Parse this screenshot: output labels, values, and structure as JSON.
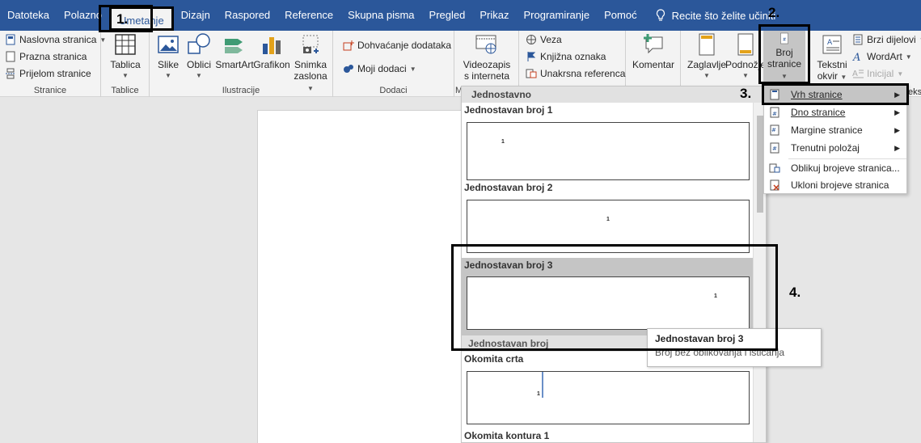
{
  "tabs": [
    "Datoteka",
    "Polazno",
    "Umetanje",
    "Dizajn",
    "Raspored",
    "Reference",
    "Skupna pisma",
    "Pregled",
    "Prikaz",
    "Programiranje",
    "Pomoć"
  ],
  "tell_me": "Recite što želite učiniti",
  "ribbon": {
    "stranice": {
      "label": "Stranice",
      "items": [
        "Naslovna stranica",
        "Prazna stranica",
        "Prijelom stranice"
      ]
    },
    "tablice": {
      "label": "Tablice",
      "button": "Tablica"
    },
    "ilustracije": {
      "label": "Ilustracije",
      "slike": "Slike",
      "oblici": "Oblici",
      "smartart": "SmartArt",
      "grafikon": "Grafikon",
      "snimka_l1": "Snimka",
      "snimka_l2": "zaslona"
    },
    "dodaci": {
      "label": "Dodaci",
      "dohvacanje": "Dohvaćanje dodataka",
      "moji": "Moji dodaci"
    },
    "mediji": {
      "label": "M",
      "l1": "Videozapis",
      "l2": "s interneta"
    },
    "veze": {
      "veza": "Veza",
      "knjizna": "Knjižna oznaka",
      "unakrsna": "Unakrsna referenca"
    },
    "komentar": "Komentar",
    "zaglavlje": {
      "zaglavlje": "Zaglavlje",
      "podnozje": "Podnožje",
      "broj_l1": "Broj",
      "broj_l2": "stranice"
    },
    "tekst": {
      "tekstni_l1": "Tekstni",
      "tekstni_l2": "okvir",
      "brzi": "Brzi dijelovi",
      "wordart": "WordArt",
      "inicijal": "Inicijal",
      "cut": "ekst"
    }
  },
  "gallery": {
    "header": "Jednostavno",
    "items": [
      {
        "title": "Jednostavan broj 1",
        "num": "1"
      },
      {
        "title": "Jednostavan broj 2",
        "num": "1"
      },
      {
        "title": "Jednostavan broj 3",
        "num": "1"
      },
      {
        "title": "Jednostavan broj",
        "num": ""
      },
      {
        "title": "Okomita crta",
        "num": "1"
      },
      {
        "title": "Okomita kontura 1",
        "num": ""
      }
    ]
  },
  "submenu": {
    "items": [
      "Vrh stranice",
      "Dno stranice",
      "Margine stranice",
      "Trenutni položaj",
      "Oblikuj brojeve stranica...",
      "Ukloni brojeve stranica"
    ]
  },
  "tooltip": {
    "title": "Jednostavan broj 3",
    "desc": "Broj bez oblikovanja i isticanja"
  },
  "annotations": [
    "1.",
    "2.",
    "3.",
    "4."
  ],
  "colors": {
    "ribbon_blue": "#2b579a",
    "highlight": "#c5c5c5"
  }
}
